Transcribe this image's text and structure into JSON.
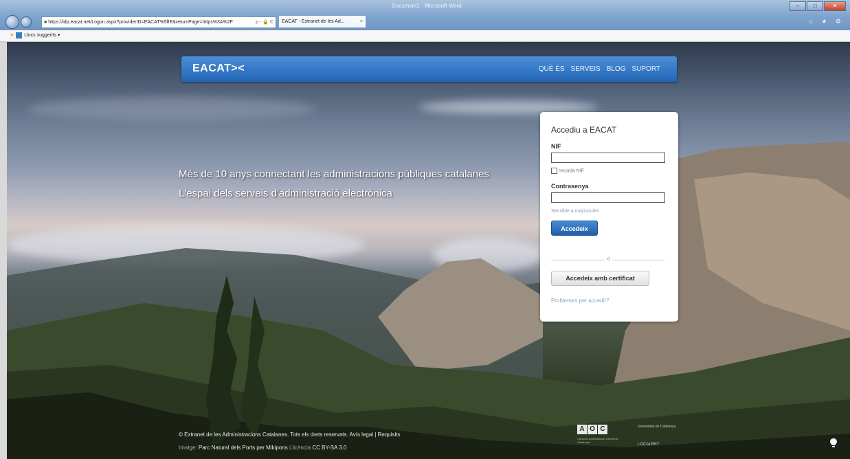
{
  "browser": {
    "url": "https://idp.eacat.net/Logon.aspx?providerID=EACAT%5fIE&returnPage=https%3A%2F",
    "tab_title": "EACAT - Extranet de les Ad...",
    "tab_close": "×",
    "doc_title": "Document1 · Microsoft Word",
    "address_tools": "ρ - 🔒 C",
    "favorites_label": "Llocs suggerits ▾",
    "window_buttons": [
      "–",
      "□",
      "✕"
    ],
    "toolbar_icons": "⌂ ★ ⚙"
  },
  "nav": {
    "logo": "EACAT><",
    "menu": [
      "QUÈ ÉS",
      "SERVEIS",
      "BLOG",
      "SUPORT"
    ]
  },
  "hero": {
    "line1": "Més de 10 anys connectant les administracions públiques catalanes",
    "line2": "L'espai dels serveis d'administració electrònica"
  },
  "login": {
    "title": "Accediu a EACAT",
    "nif_label": "NIF",
    "nif_value": "",
    "remember_label": "recorda NIF",
    "password_label": "Contrasenya",
    "password_value": "",
    "case_hint": "Sensible a majúscules",
    "submit": "Accedeix",
    "separator": "o",
    "certificate_button": "Accedeix amb certificat",
    "problems_link": "Problemes per accedir?"
  },
  "footer": {
    "copyright": "© Extranet de les Administracions Catalanes. Tots els drets reservats.",
    "legal_link": "Avís legal",
    "sep": "|",
    "requirements_link": "Requisits",
    "image_label": "Imatge:",
    "image_credit": "Parc Natural dels Ports per Mikipons",
    "license_label": "Llicència",
    "license_value": "CC BY-SA 3.0"
  },
  "logos": {
    "aoc_letters": [
      "A",
      "O",
      "C"
    ],
    "aoc_sub": "Consorci Administració Oberta de Catalunya",
    "gencat": "Generalitat de Catalunya",
    "localret": "LOCALRET"
  },
  "colors": {
    "nav_blue": "#2f76c9",
    "button_blue": "#2a6cbd",
    "link": "#8aa7c6"
  }
}
